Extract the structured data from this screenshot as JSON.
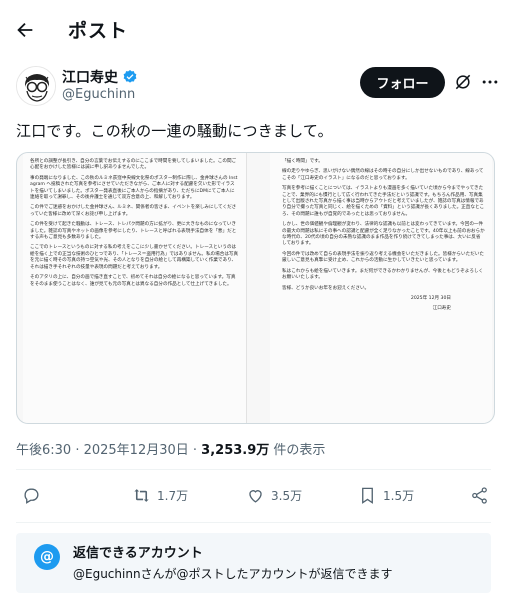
{
  "header": {
    "back_icon": "arrow-left-icon",
    "title": "ポスト"
  },
  "author": {
    "name": "江口寿史",
    "handle": "@Eguchinn",
    "verified_color": "#1d9bf0",
    "follow_label": "フォロー",
    "grok_icon": "grok-icon",
    "more_icon": "more-horizontal-icon"
  },
  "post": {
    "text": "江口です。この秋の一連の騒動につきまして。",
    "image_left": [
      "各所との調整が長引き、自分の言葉でお伝えするのにここまで時間を要してしまいました。この間ご心配をおかけした皆様には誠に申し訳ありませんでした。",
      "事の発端になりました、この秋のルミネ荻窪中央線文化祭のポスター制作に際し、金井球さんの Instagram へ投稿された写真を参考にさせていただきながら、ご本人に対する配慮を欠いた形でイラストを描いてしまいました。ポスター発表直後にご本人からの指摘があり、ただちにDMにてご本人に連絡を取って謝罪し、その後弁護士を通じて双方合意の上、和解しております。",
      "この件でご迷惑をおかけした金井球さん、ルミネ、関係者の皆さま、イベントを楽しみにしてくださっていた皆様に改めて深くお詫び申し上げます。",
      "この件を受けて起きた騒動は、トレース、トレパク問題の方に拡がり、更に大きなものになっていきました。雑誌の写真やネットの画像を参考にしたり、トレースと呼ばれる表現手法自体を「悪」だとする声もご意見も多数ありました。",
      "ここでのトレースというものに対する私の考えをここに少し書かせてください。トレースというのは絵を描く上での正当な技術のひとつであり、「トレース＝盗用行為」ではありません。私の場合は写真を元に描く時その写真の持つ空気や光、その人となりを自分の絵として再構築していく作業であり、それは描き手それぞれの技量や表現の問題だと考えております。",
      "そのアタリの上に、自分の画で描き直すことで、初めてそれは自分の絵になると思っています。写真をそのまま使うことはなく、誰が見ても元の写真とは異なる自分の作品として仕上げてきました。"
    ],
    "image_right": [
      "「描く時間」です。",
      "線の走りやゆらぎ、思いがけない偶然の線はその時その自分にしか出せないものであり、線あってこその「江口寿史のイラスト」になるのだと思っております。",
      "写真を参考に描くことについては、イラストよりも漫画を多く描いていた頃から今までやってきたことで、業界的にも慣行として広く行われてきた手法だという認識です。もちろん作品用、写真集として出版された写真から描く事は当時からアウトだと考えていましたが、雑誌の写真は情報であり自分で撮った写真と同じく、絵を描くための「資料」という認識が長くありました。正直なところ、その問題に誰もが自覚的であったとは思っておりません。",
      "しかし、世の価値観や倫理観が変わり、法律的な認識も以前とは変わってきています。今回の一件の最大の問題は私にその事への認識と配慮が全く足りなかったことです。40年以上も前のおおらかな時代の、20代の頃の自分の未熟な認識のまま作品を作り続けてきてしまった事は、大いに反省しております。",
      "今回の件では改めて自らの表現手法を振り返り考える機会をいただきました。皆様からいただいた厳しいご意見も真摯に受け止め、これからの活動に生かしていきたいと思っています。",
      "私はこれからも絵を描いていきます。まだ何ができるかわかりませんが、今後ともどうぞよろしくお願いいたします。",
      "皆様、どうか良いお年をお迎えください。"
    ],
    "sign_date": "2025年 12月 30日",
    "sign_name": "江口寿史"
  },
  "meta": {
    "time": "午後6:30 · 2025年12月30日 ·",
    "views": "3,253.9万",
    "views_suffix": "件の表示"
  },
  "actions": {
    "reply_icon": "reply-icon",
    "retweets": "1.7万",
    "likes": "3.5万",
    "bookmarks": "1.5万",
    "share_icon": "share-icon"
  },
  "reply_restriction": {
    "icon_glyph": "@",
    "title": "返信できるアカウント",
    "subtitle": "@Eguchinnさんが@ポストしたアカウントが返信できます"
  }
}
